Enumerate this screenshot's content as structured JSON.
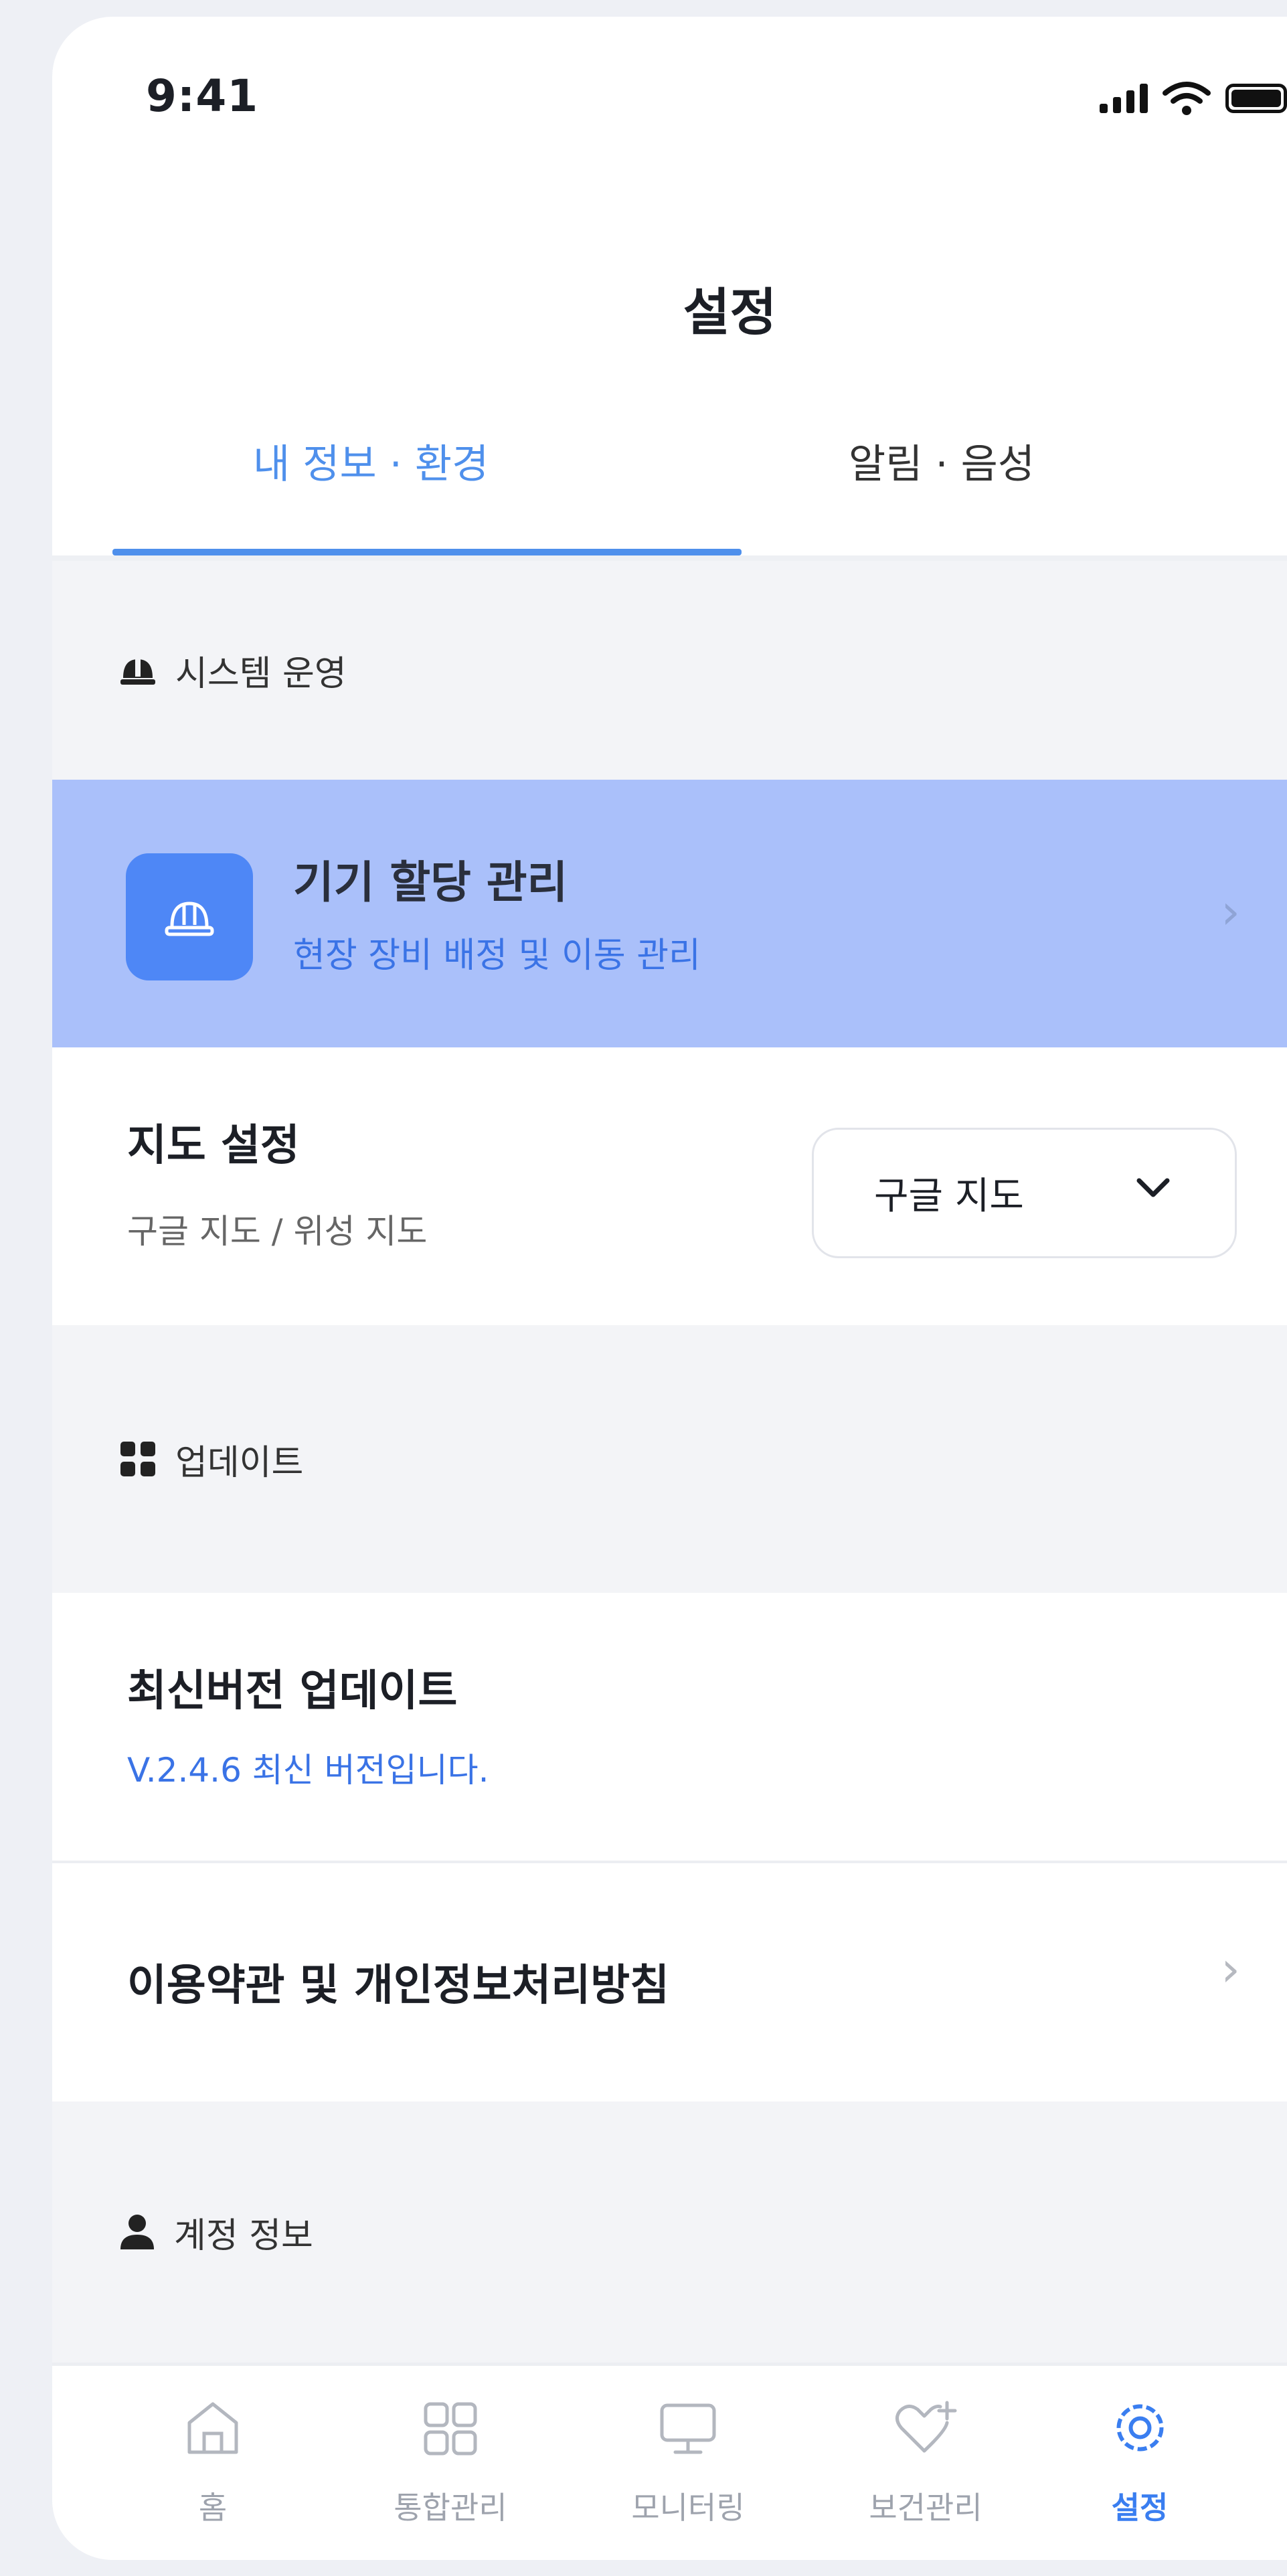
{
  "status_bar": {
    "time": "9:41"
  },
  "header": {
    "title": "설정"
  },
  "tabs": [
    {
      "label": "내 정보 · 환경",
      "active": true
    },
    {
      "label": "알림 · 음성",
      "active": false
    }
  ],
  "sections": {
    "system": {
      "label": "시스템 운영",
      "device_assignment": {
        "title": "기기 할당 관리",
        "subtitle": "현장 장비 배정 및 이동 관리"
      },
      "map": {
        "title": "지도 설정",
        "subtitle": "구글 지도 / 위성 지도",
        "selected": "구글 지도"
      }
    },
    "update": {
      "label": "업데이트",
      "latest": {
        "title": "최신버전 업데이트",
        "version_text": "V.2.4.6 최신 버전입니다."
      },
      "terms": {
        "title": "이용약관 및 개인정보처리방침"
      }
    },
    "account": {
      "label": "계정 정보"
    }
  },
  "bottom_nav": [
    {
      "label": "홈",
      "icon": "home-icon",
      "active": false
    },
    {
      "label": "통합관리",
      "icon": "grid-icon",
      "active": false
    },
    {
      "label": "모니터링",
      "icon": "monitor-icon",
      "active": false
    },
    {
      "label": "보건관리",
      "icon": "heart-plus-icon",
      "active": false
    },
    {
      "label": "설정",
      "icon": "gear-icon",
      "active": true
    }
  ],
  "colors": {
    "accent": "#4f90ec",
    "highlight_row": "#aac0fa",
    "icon_tile": "#4e87f6"
  }
}
